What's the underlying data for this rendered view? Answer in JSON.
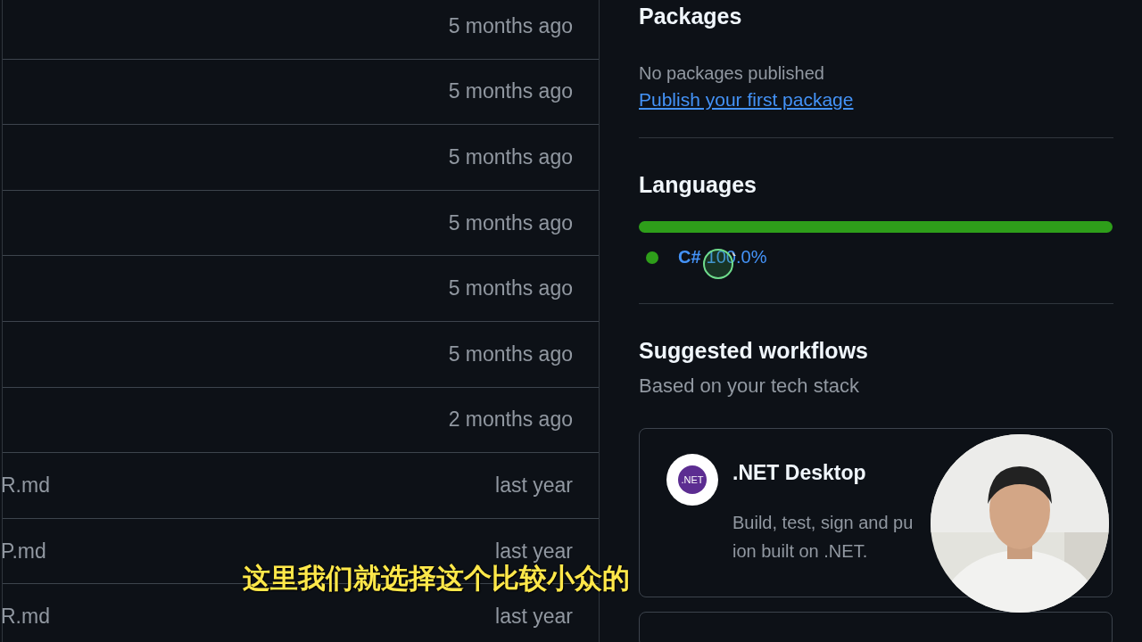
{
  "file_list": {
    "rows": [
      {
        "updated": "5 months ago"
      },
      {
        "updated": "5 months ago"
      },
      {
        "updated": "5 months ago"
      },
      {
        "updated": "5 months ago"
      },
      {
        "updated": "5 months ago"
      },
      {
        "updated": "5 months ago"
      },
      {
        "updated": "2 months ago"
      },
      {
        "name": "R.md",
        "updated": "last year"
      },
      {
        "name": "P.md",
        "updated": "last year"
      },
      {
        "name": "R.md",
        "updated": "last year"
      }
    ]
  },
  "sidebar": {
    "packages": {
      "title": "Packages",
      "empty_text": "No packages published",
      "link": "Publish your first package"
    },
    "languages": {
      "title": "Languages",
      "items": [
        {
          "name": "C#",
          "percent": "100.0%",
          "level": 1,
          "color": "#2e9e1a"
        }
      ]
    },
    "suggested_workflows": {
      "title": "Suggested workflows",
      "subtitle": "Based on your tech stack",
      "cards": [
        {
          "icon_text": ".NET",
          "title": ".NET Desktop",
          "description_lines": [
            "Build, test, sign and pu",
            "ion built on .NET."
          ]
        }
      ]
    }
  },
  "video_overlay": {
    "subtitle": "这里我们就选择这个比较小众的"
  }
}
